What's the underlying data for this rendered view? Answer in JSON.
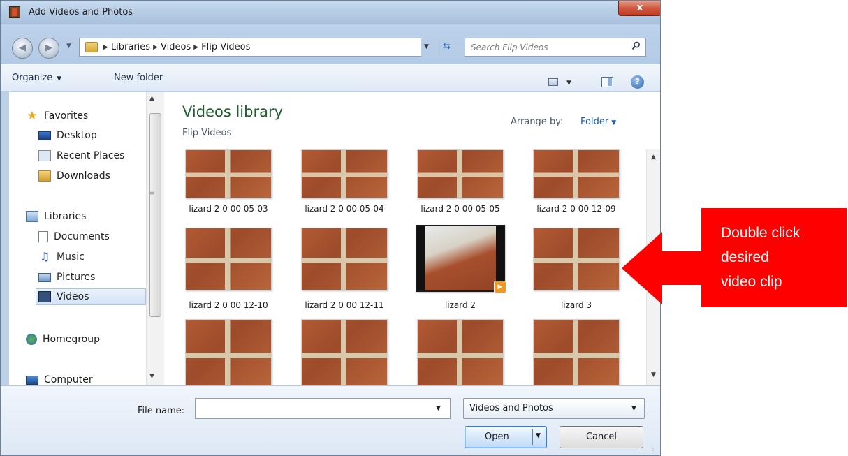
{
  "window": {
    "title": "Add Videos and Photos",
    "close_label": "x"
  },
  "address": {
    "crumbs": [
      "Libraries",
      "Videos",
      "Flip Videos"
    ],
    "search_placeholder": "Search Flip Videos"
  },
  "toolbar": {
    "organize_label": "Organize",
    "new_folder_label": "New folder"
  },
  "nav": {
    "favorites": "Favorites",
    "desktop": "Desktop",
    "recent_places": "Recent Places",
    "downloads": "Downloads",
    "libraries": "Libraries",
    "documents": "Documents",
    "music": "Music",
    "pictures": "Pictures",
    "videos": "Videos",
    "homegroup": "Homegroup",
    "computer": "Computer"
  },
  "library": {
    "title": "Videos library",
    "subtitle": "Flip Videos",
    "arrange_label": "Arrange by:",
    "arrange_value": "Folder"
  },
  "files": [
    {
      "name": "lizard 2 0 00 05-03"
    },
    {
      "name": "lizard 2 0 00 05-04"
    },
    {
      "name": "lizard 2 0 00 05-05"
    },
    {
      "name": "lizard 2 0 00 12-09"
    },
    {
      "name": "lizard 2 0 00 12-10"
    },
    {
      "name": "lizard 2 0 00 12-11"
    },
    {
      "name": "lizard 2"
    },
    {
      "name": "lizard 3"
    }
  ],
  "footer": {
    "file_name_label": "File name:",
    "file_name_value": "",
    "file_type_value": "Videos and Photos",
    "open_label": "Open",
    "cancel_label": "Cancel"
  },
  "annotation": {
    "text": "Double click\ndesired\nvideo clip",
    "color": "#ff0000"
  }
}
